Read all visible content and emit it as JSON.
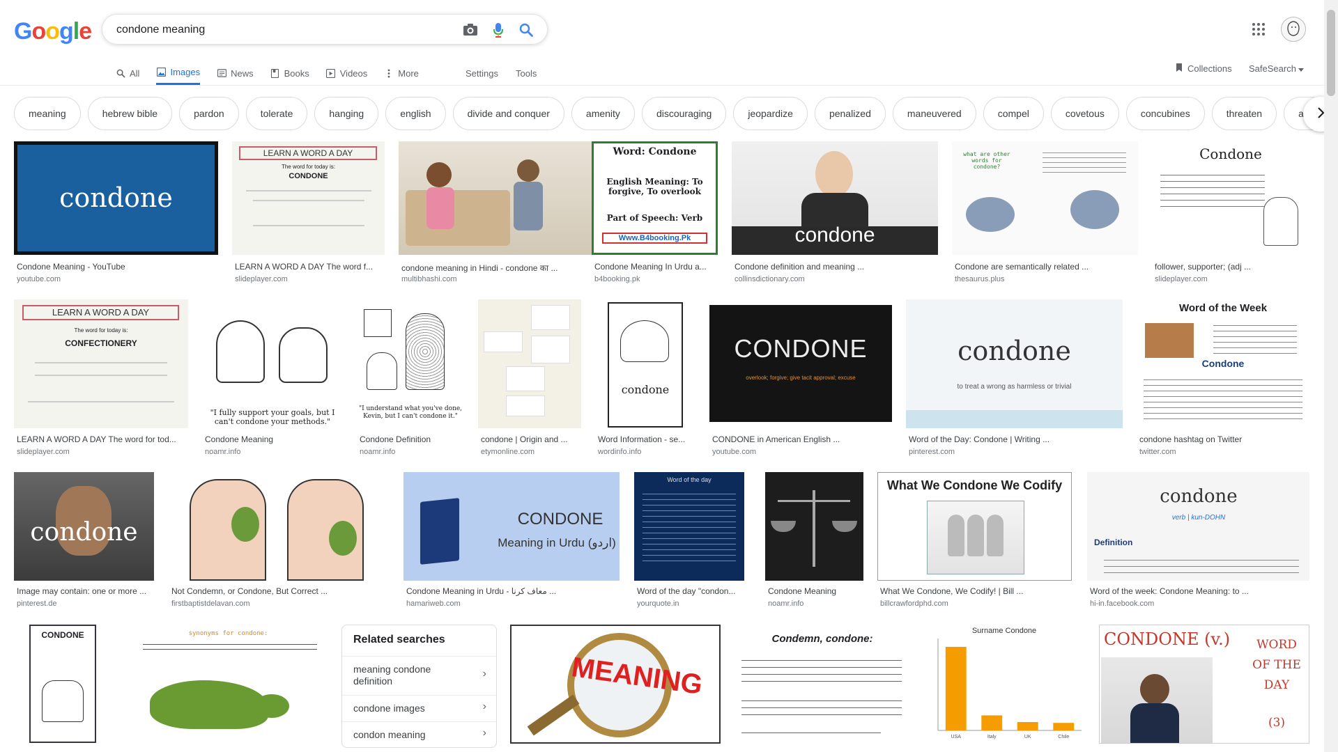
{
  "logo": {
    "letters": [
      "G",
      "o",
      "o",
      "g",
      "l",
      "e"
    ],
    "colors": [
      "#4285F4",
      "#EA4335",
      "#FBBC05",
      "#4285F4",
      "#34A853",
      "#EA4335"
    ]
  },
  "search": {
    "query": "condone meaning",
    "placeholder": ""
  },
  "tabs": [
    {
      "label": "All",
      "icon": "search-icon"
    },
    {
      "label": "Images",
      "icon": "image-icon",
      "active": true
    },
    {
      "label": "News",
      "icon": "news-icon"
    },
    {
      "label": "Books",
      "icon": "book-icon"
    },
    {
      "label": "Videos",
      "icon": "video-icon"
    },
    {
      "label": "More",
      "icon": "more-vert-icon"
    }
  ],
  "tools": {
    "settings": "Settings",
    "tools": "Tools",
    "collections": "Collections",
    "safesearch": "SafeSearch"
  },
  "chips": [
    "meaning",
    "hebrew bible",
    "pardon",
    "tolerate",
    "hanging",
    "english",
    "divide and conquer",
    "amenity",
    "discouraging",
    "jeopardize",
    "penalized",
    "maneuvered",
    "compel",
    "covetous",
    "concubines",
    "threaten",
    "appa"
  ],
  "results": [
    {
      "caption": "Condone Meaning - YouTube",
      "source": "youtube.com",
      "thumb_text": "condone"
    },
    {
      "caption": "LEARN A WORD A DAY The word f...",
      "source": "slideplayer.com",
      "thumb_text": "LEARN A WORD A DAY",
      "thumb_sub": "The word for today is:",
      "thumb_word": "CONDONE"
    },
    {
      "caption": "condone meaning in Hindi - condone का ...",
      "source": "multibhashi.com"
    },
    {
      "caption": "Condone Meaning In Urdu a...",
      "source": "b4booking.pk",
      "thumb_text": "Word: Condone",
      "thumb_sub": "English Meaning: To forgive, To overlook",
      "thumb_word": "Part of Speech: Verb",
      "thumb_url": "Www.B4booking.Pk"
    },
    {
      "caption": "Condone definition and meaning ...",
      "source": "collinsdictionary.com",
      "thumb_text": "condone"
    },
    {
      "caption": "Condone are semantically related ...",
      "source": "thesaurus.plus",
      "thumb_text": "what are other words for condone?"
    },
    {
      "caption": "follower, supporter; (adj ...",
      "source": "slideplayer.com",
      "thumb_text": "Condone"
    },
    {
      "caption": "LEARN A WORD A DAY The word for tod...",
      "source": "slideplayer.com",
      "thumb_text": "LEARN A WORD A DAY",
      "thumb_sub": "The word for today is:",
      "thumb_word": "CONFECTIONERY"
    },
    {
      "caption": "Condone Meaning",
      "source": "noamr.info",
      "thumb_text": "\"I fully support your goals, but I can't condone your methods.\""
    },
    {
      "caption": "Condone Definition",
      "source": "noamr.info",
      "thumb_text": "\"I understand what you've done, Kevin, but I can't condone it.\""
    },
    {
      "caption": "condone | Origin and ...",
      "source": "etymonline.com"
    },
    {
      "caption": "Word Information - se...",
      "source": "wordinfo.info",
      "thumb_text": "condone"
    },
    {
      "caption": "CONDONE in American English ...",
      "source": "youtube.com",
      "thumb_text": "CONDONE",
      "thumb_sub": "overlook; forgive; give tacit approval; excuse"
    },
    {
      "caption": "Word of the Day: Condone | Writing ...",
      "source": "pinterest.com",
      "thumb_text": "condone",
      "thumb_sub": "to treat a wrong as harmless or trivial"
    },
    {
      "caption": "condone hashtag on Twitter",
      "source": "twitter.com",
      "thumb_text": "Word of the Week",
      "thumb_word": "Condone"
    },
    {
      "caption": "Image may contain: one or more ...",
      "source": "pinterest.de",
      "thumb_text": "condone"
    },
    {
      "caption": "Not Condemn, or Condone, But Correct ...",
      "source": "firstbaptistdelavan.com"
    },
    {
      "caption": "Condone Meaning in Urdu - معاف کرنا ...",
      "source": "hamariweb.com",
      "thumb_text": "CONDONE",
      "thumb_sub": "Meaning in Urdu (اردو)"
    },
    {
      "caption": "Word of the day \"condon...",
      "source": "yourquote.in",
      "thumb_text": "Word of the day"
    },
    {
      "caption": "Condone Meaning",
      "source": "noamr.info"
    },
    {
      "caption": "What We Condone, We Codify! | Bill ...",
      "source": "billcrawfordphd.com",
      "thumb_text": "What We Condone We Codify"
    },
    {
      "caption": "Word of the week: Condone Meaning: to ...",
      "source": "hi-in.facebook.com",
      "thumb_text": "condone",
      "thumb_sub": "verb | kun-DOHN",
      "thumb_word": "Definition"
    },
    {
      "thumb_text": "CONDONE"
    },
    {
      "thumb_text": "synonyms for condone:"
    },
    {
      "thumb_text": "MEANING"
    },
    {
      "thumb_text": "Condemn, condone:"
    },
    {
      "thumb_text": "Surname Condone"
    },
    {
      "thumb_text": "CONDONE (v.)",
      "thumb_sub": "WORD OF THE DAY",
      "thumb_word": "(3)"
    }
  ],
  "related": {
    "title": "Related searches",
    "items": [
      "meaning condone definition",
      "condone images",
      "condon meaning"
    ]
  },
  "chart_data": {
    "type": "bar",
    "title": "Surname Condone",
    "categories": [
      "USA",
      "Italy",
      "UK",
      "Chile"
    ],
    "values": [
      100,
      18,
      10,
      9
    ],
    "ylim": [
      0,
      110
    ]
  },
  "colors": {
    "accent": "#1a73e8",
    "chart_bar": "#f59c00"
  }
}
